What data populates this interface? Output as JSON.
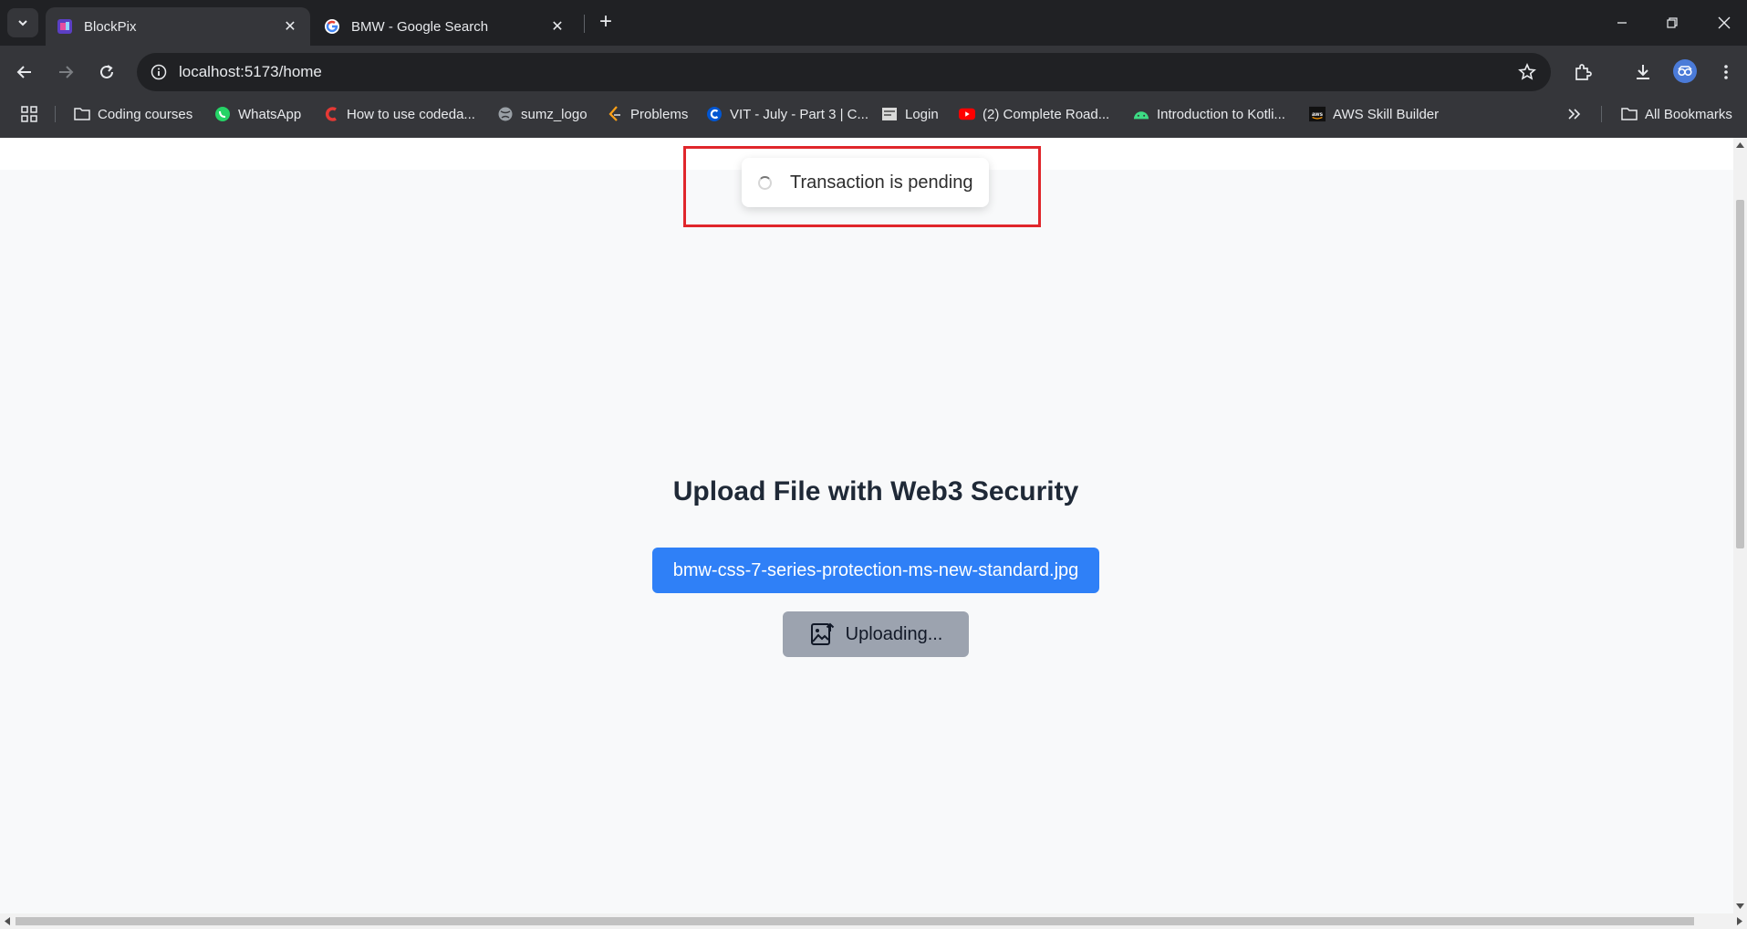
{
  "browser": {
    "tabs": [
      {
        "title": "BlockPix",
        "favicon": "blockpix-icon",
        "active": true
      },
      {
        "title": "BMW - Google Search",
        "favicon": "google-icon",
        "active": false
      }
    ],
    "url": "localhost:5173/home",
    "bookmarks": [
      {
        "label": "Coding courses",
        "icon": "folder-icon"
      },
      {
        "label": "WhatsApp",
        "icon": "whatsapp-icon"
      },
      {
        "label": "How to use codeda...",
        "icon": "codedamn-icon"
      },
      {
        "label": "sumz_logo",
        "icon": "globe-icon"
      },
      {
        "label": "Problems",
        "icon": "leetcode-icon"
      },
      {
        "label": "VIT - July - Part 3 | C...",
        "icon": "coursera-icon"
      },
      {
        "label": "Login",
        "icon": "login-page-icon"
      },
      {
        "label": "(2) Complete Road...",
        "icon": "youtube-icon"
      },
      {
        "label": "Introduction to Kotli...",
        "icon": "android-icon"
      },
      {
        "label": "AWS Skill Builder",
        "icon": "aws-icon"
      }
    ],
    "all_bookmarks_label": "All Bookmarks"
  },
  "toast": {
    "message": "Transaction is pending"
  },
  "upload": {
    "title": "Upload File with Web3 Security",
    "file_name": "bmw-css-7-series-protection-ms-new-standard.jpg",
    "upload_label": "Uploading..."
  },
  "colors": {
    "highlight": "#e0262b",
    "file_button": "#2f80f7",
    "upload_button_disabled": "#9ca3af"
  }
}
